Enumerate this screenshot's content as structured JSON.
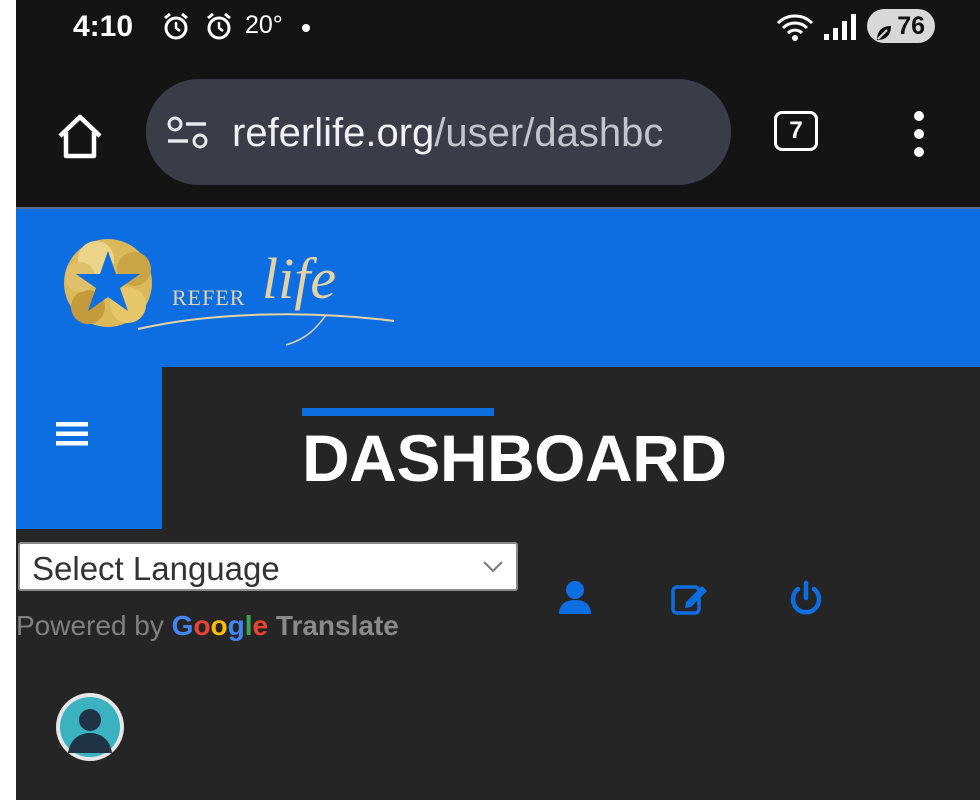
{
  "status_bar": {
    "time": "4:10",
    "temperature": "20°",
    "battery": "76",
    "icons": [
      "alarm-icon",
      "alarm-icon",
      "dot-icon",
      "wifi-icon",
      "signal-icon",
      "battery-saver-icon"
    ]
  },
  "browser": {
    "url_domain": "referlife.org",
    "url_path": "/user/dashbc",
    "tab_count": "7",
    "icons": [
      "home-icon",
      "site-settings-icon",
      "tab-switcher-icon",
      "more-vert-icon"
    ]
  },
  "site": {
    "logo_refer": "Refer",
    "logo_life": "life",
    "page_title": "DASHBOARD",
    "language_select": "Select Language",
    "powered_by": "Powered by",
    "google": "Google",
    "translate": "Translate",
    "icons": [
      "hamburger-menu-icon",
      "user-icon",
      "edit-icon",
      "power-icon",
      "avatar-icon"
    ]
  },
  "colors": {
    "brand_blue": "#0d6ee2",
    "gold": "#e3d3a4",
    "dark_bg": "#252525",
    "browser_bg": "#141414"
  }
}
